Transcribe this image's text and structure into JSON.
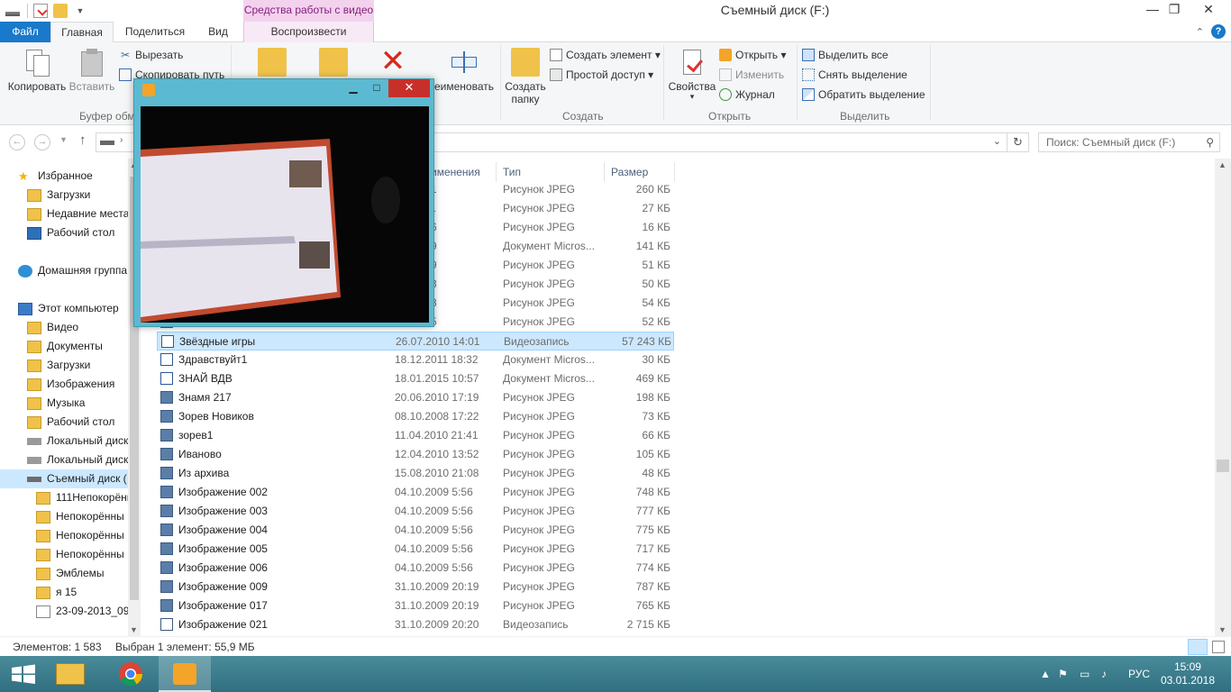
{
  "window": {
    "title": "Съемный диск (F:)",
    "context_tab_header": "Средства работы с видео",
    "minimize": "—",
    "restore": "❐",
    "close": "✕"
  },
  "ribbon_tabs": {
    "file": "Файл",
    "home": "Главная",
    "share": "Поделиться",
    "view": "Вид",
    "play": "Воспроизвести"
  },
  "ribbon": {
    "copy": "Копировать",
    "paste": "Вставить",
    "cut": "Вырезать",
    "copy_path": "Скопировать путь",
    "clipboard_group": "Буфер обм",
    "rename": "еименовать",
    "new_folder_line1": "Создать",
    "new_folder_line2": "папку",
    "new_item": "Создать элемент ▾",
    "easy_access": "Простой доступ ▾",
    "create_group": "Создать",
    "properties": "Свойства",
    "properties_arrow": "▾",
    "open": "Открыть ▾",
    "edit": "Изменить",
    "history": "Журнал",
    "open_group": "Открыть",
    "select_all": "Выделить все",
    "select_none": "Снять выделение",
    "invert_selection": "Обратить выделение",
    "select_group": "Выделить"
  },
  "address": {
    "search_placeholder": "Поиск: Съемный диск (F:)"
  },
  "nav": {
    "items": [
      {
        "label": "Избранное",
        "icon": "star-icon"
      },
      {
        "label": "Загрузки",
        "icon": "folder-icon"
      },
      {
        "label": "Недавние места",
        "icon": "folder-icon"
      },
      {
        "label": "Рабочий стол",
        "icon": "desktop-icon"
      },
      {
        "label": "Домашняя группа",
        "icon": "homegroup-icon"
      },
      {
        "label": "Этот компьютер",
        "icon": "computer-icon"
      },
      {
        "label": "Видео",
        "icon": "folder-icon"
      },
      {
        "label": "Документы",
        "icon": "folder-icon"
      },
      {
        "label": "Загрузки",
        "icon": "folder-icon"
      },
      {
        "label": "Изображения",
        "icon": "folder-icon"
      },
      {
        "label": "Музыка",
        "icon": "folder-icon"
      },
      {
        "label": "Рабочий стол",
        "icon": "folder-icon"
      },
      {
        "label": "Локальный диск",
        "icon": "drive-icon"
      },
      {
        "label": "Локальный диск",
        "icon": "drive-icon"
      },
      {
        "label": "Съемный диск (",
        "icon": "removable-drive-icon"
      },
      {
        "label": "111Непокорённ",
        "icon": "folder-icon"
      },
      {
        "label": "Непокорённы",
        "icon": "folder-icon"
      },
      {
        "label": "Непокорённы",
        "icon": "folder-icon"
      },
      {
        "label": "Непокорённы",
        "icon": "folder-icon"
      },
      {
        "label": "Эмблемы",
        "icon": "folder-icon"
      },
      {
        "label": "я 15",
        "icon": "folder-icon"
      },
      {
        "label": "23-09-2013_09-",
        "icon": "file-icon"
      }
    ]
  },
  "columns": {
    "modified": "именения",
    "type": "Тип",
    "size": "Размер"
  },
  "files": [
    {
      "name": "",
      "date": "10 10:41",
      "type": "Рисунок JPEG",
      "size": "260 КБ",
      "icon": "image-file-icon"
    },
    {
      "name": "",
      "date": "11 20:31",
      "type": "Рисунок JPEG",
      "size": "27 КБ",
      "icon": "image-file-icon"
    },
    {
      "name": "",
      "date": "10 10:46",
      "type": "Рисунок JPEG",
      "size": "16 КБ",
      "icon": "image-file-icon"
    },
    {
      "name": "",
      "date": "09 13:19",
      "type": "Документ Micros...",
      "size": "141 КБ",
      "icon": "word-file-icon"
    },
    {
      "name": "",
      "date": "10 20:39",
      "type": "Рисунок JPEG",
      "size": "51 КБ",
      "icon": "image-file-icon"
    },
    {
      "name": "",
      "date": "10 20:43",
      "type": "Рисунок JPEG",
      "size": "50 КБ",
      "icon": "image-file-icon"
    },
    {
      "name": "",
      "date": "10 20:48",
      "type": "Рисунок JPEG",
      "size": "54 КБ",
      "icon": "image-file-icon"
    },
    {
      "name": "",
      "date": "10 16:25",
      "type": "Рисунок JPEG",
      "size": "52 КБ",
      "icon": "image-file-icon"
    },
    {
      "name": "Звёздные игры",
      "date": "26.07.2010 14:01",
      "type": "Видеозапись",
      "size": "57 243 КБ",
      "icon": "video-file-icon"
    },
    {
      "name": "Здравствуйт1",
      "date": "18.12.2011 18:32",
      "type": "Документ Micros...",
      "size": "30 КБ",
      "icon": "word-file-icon"
    },
    {
      "name": "ЗНАЙ ВДВ",
      "date": "18.01.2015 10:57",
      "type": "Документ Micros...",
      "size": "469 КБ",
      "icon": "word-file-icon"
    },
    {
      "name": "Знамя 217",
      "date": "20.06.2010 17:19",
      "type": "Рисунок JPEG",
      "size": "198 КБ",
      "icon": "image-file-icon"
    },
    {
      "name": "Зорев Новиков",
      "date": "08.10.2008 17:22",
      "type": "Рисунок JPEG",
      "size": "73 КБ",
      "icon": "image-file-icon"
    },
    {
      "name": "зорев1",
      "date": "11.04.2010 21:41",
      "type": "Рисунок JPEG",
      "size": "66 КБ",
      "icon": "image-file-icon"
    },
    {
      "name": "Иваново",
      "date": "12.04.2010 13:52",
      "type": "Рисунок JPEG",
      "size": "105 КБ",
      "icon": "image-file-icon"
    },
    {
      "name": "Из архива",
      "date": "15.08.2010 21:08",
      "type": "Рисунок JPEG",
      "size": "48 КБ",
      "icon": "image-file-icon"
    },
    {
      "name": "Изображение 002",
      "date": "04.10.2009 5:56",
      "type": "Рисунок JPEG",
      "size": "748 КБ",
      "icon": "image-file-icon"
    },
    {
      "name": "Изображение 003",
      "date": "04.10.2009 5:56",
      "type": "Рисунок JPEG",
      "size": "777 КБ",
      "icon": "image-file-icon"
    },
    {
      "name": "Изображение 004",
      "date": "04.10.2009 5:56",
      "type": "Рисунок JPEG",
      "size": "775 КБ",
      "icon": "image-file-icon"
    },
    {
      "name": "Изображение 005",
      "date": "04.10.2009 5:56",
      "type": "Рисунок JPEG",
      "size": "717 КБ",
      "icon": "image-file-icon"
    },
    {
      "name": "Изображение 006",
      "date": "04.10.2009 5:56",
      "type": "Рисунок JPEG",
      "size": "774 КБ",
      "icon": "image-file-icon"
    },
    {
      "name": "Изображение 009",
      "date": "31.10.2009 20:19",
      "type": "Рисунок JPEG",
      "size": "787 КБ",
      "icon": "image-file-icon"
    },
    {
      "name": "Изображение 017",
      "date": "31.10.2009 20:19",
      "type": "Рисунок JPEG",
      "size": "765 КБ",
      "icon": "image-file-icon"
    },
    {
      "name": "Изображение 021",
      "date": "31.10.2009 20:20",
      "type": "Видеозапись",
      "size": "2 715 КБ",
      "icon": "video-file-icon"
    }
  ],
  "status": {
    "items_count": "Элементов: 1 583",
    "selection": "Выбран 1 элемент: 55,9 МБ"
  },
  "taskbar": {
    "language": "РУС",
    "time": "15:09",
    "date": "03.01.2018"
  },
  "colors": {
    "accent": "#1979ca",
    "selection": "#cce8ff",
    "context_tab": "#f3d2ee",
    "video_window": "#5bbad1",
    "taskbar": "#3b7d8d",
    "close_red": "#c7302a"
  }
}
